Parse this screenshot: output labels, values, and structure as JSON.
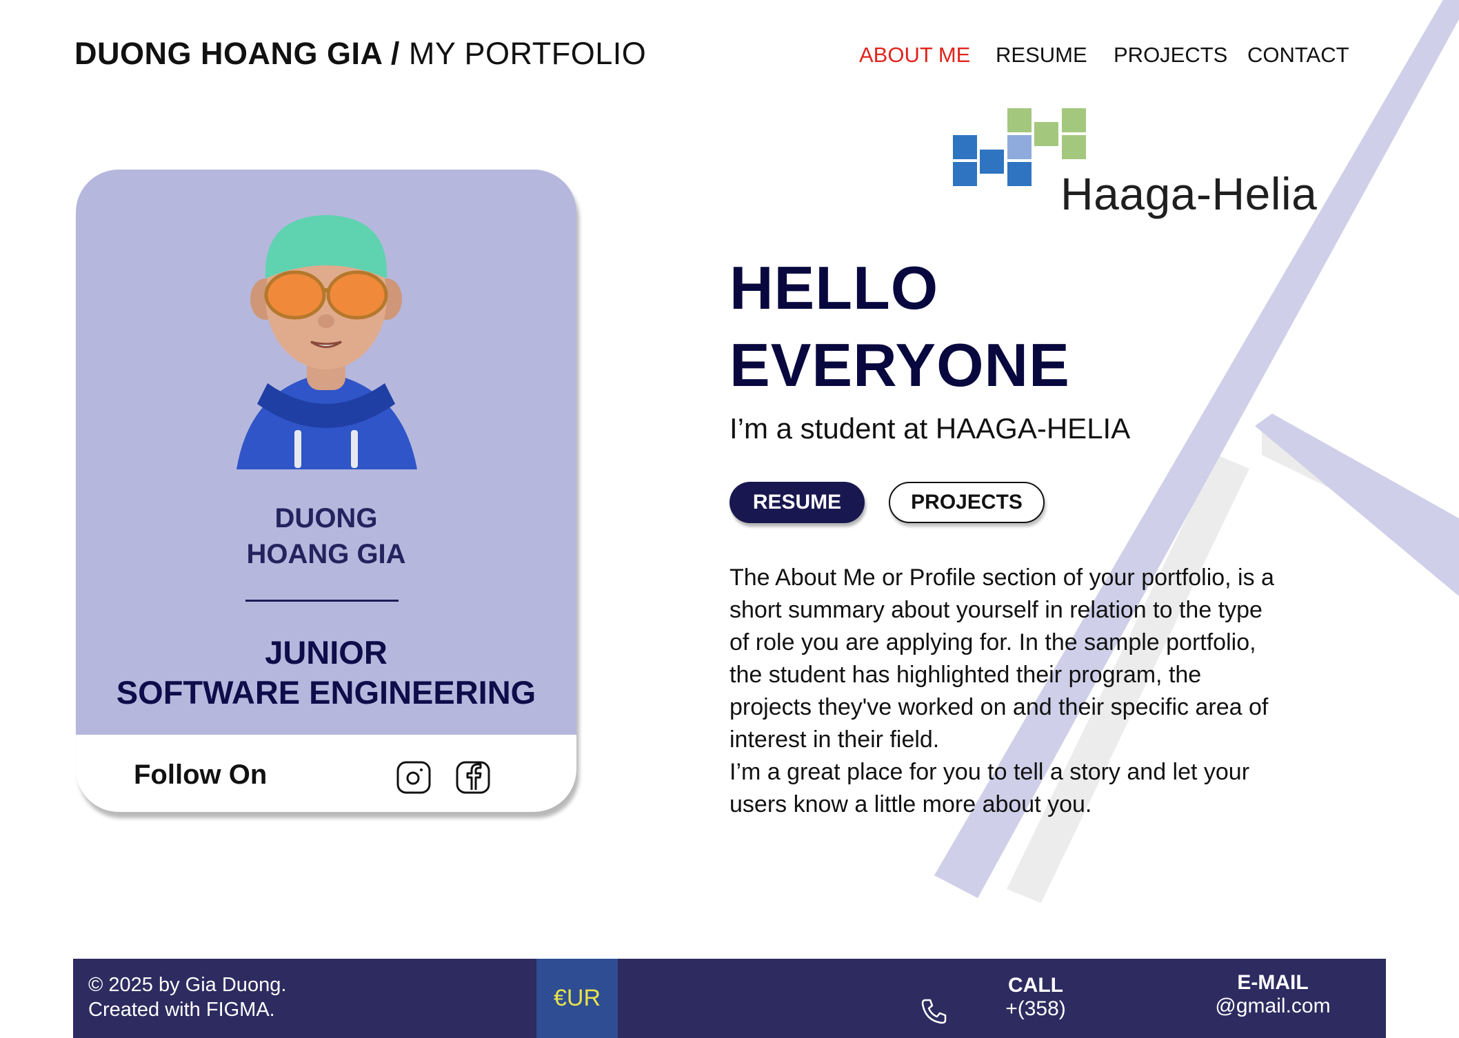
{
  "header": {
    "brand_bold": "DUONG HOANG GIA /",
    "brand_light": " MY PORTFOLIO",
    "nav": [
      {
        "label": "ABOUT ME",
        "active": true
      },
      {
        "label": "RESUME",
        "active": false
      },
      {
        "label": "PROJECTS",
        "active": false
      },
      {
        "label": "CONTACT",
        "active": false
      }
    ]
  },
  "logo": {
    "text": "Haaga-Helia"
  },
  "card": {
    "name_line1": "DUONG",
    "name_line2": "HOANG GIA",
    "role_line1": "JUNIOR",
    "role_line2": "SOFTWARE ENGINEERING",
    "follow_label": "Follow On",
    "social_icons": [
      "instagram-icon",
      "facebook-icon"
    ]
  },
  "hero": {
    "title_line1": "HELLO",
    "title_line2": "EVERYONE",
    "subtitle": "I’m a student at HAAGA-HELIA",
    "primary_button": "RESUME",
    "secondary_button": "PROJECTS",
    "paragraph_1": "The About Me or Profile section of your portfolio, is a short summary about yourself in relation to the type of role you are applying for. In the sample portfolio, the student has highlighted their program, the projects they've worked on and their specific area of interest in their field.",
    "paragraph_2": "I’m a great place for you to tell a story and let your users know a little more about you."
  },
  "footer": {
    "copyright_line1": "© 2025 by Gia Duong.",
    "copyright_line2": "Created with FIGMA.",
    "euro_label": "€UR",
    "call_label": "CALL",
    "call_value": "+(358)",
    "email_label": "E-MAIL",
    "email_value": "@gmail.com"
  },
  "colors": {
    "accent_nav": "#e0241c",
    "card_bg": "#b6b7dd",
    "navy": "#18174f",
    "footer_bg": "#2d2b60",
    "deco_lavender": "#cfcfe9"
  }
}
